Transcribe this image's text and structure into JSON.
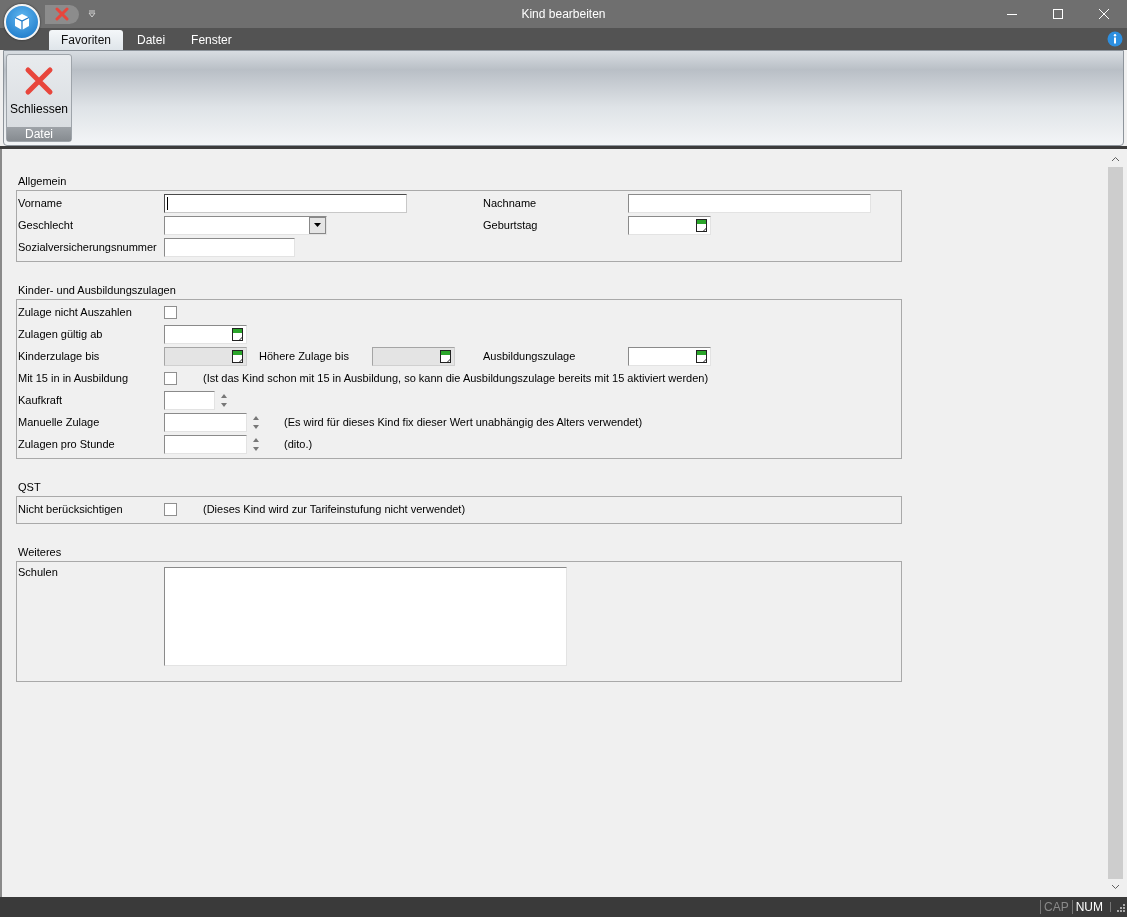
{
  "window": {
    "title": "Kind bearbeiten"
  },
  "ribbon": {
    "tabs": [
      {
        "label": "Favoriten",
        "selected": true
      },
      {
        "label": "Datei",
        "selected": false
      },
      {
        "label": "Fenster",
        "selected": false
      }
    ],
    "groups": [
      {
        "label": "Datei",
        "buttons": [
          {
            "label": "Schliessen"
          }
        ]
      }
    ]
  },
  "sections": [
    {
      "title": "Allgemein",
      "rows": [
        {
          "label": "Vorname",
          "control": {
            "kind": "text",
            "focused": true
          },
          "extras": [
            {
              "label": "Nachname",
              "control": {
                "kind": "text",
                "focused": false
              }
            }
          ]
        },
        {
          "label": "Geschlecht",
          "control": {
            "kind": "combo"
          },
          "extras": [
            {
              "label": "Geburtstag",
              "control": {
                "kind": "date",
                "disabled": false
              }
            }
          ]
        },
        {
          "label": "Sozialversicherungsnummer",
          "control": {
            "kind": "text",
            "focused": false
          }
        }
      ]
    },
    {
      "title": "Kinder- und Ausbildungszulagen",
      "rows": [
        {
          "label": "Zulage nicht Auszahlen",
          "control": {
            "kind": "checkbox",
            "checked": false
          }
        },
        {
          "label": "Zulagen gültig ab",
          "control": {
            "kind": "date",
            "disabled": false
          }
        },
        {
          "label": "Kinderzulage bis",
          "control": {
            "kind": "date",
            "disabled": true
          },
          "extras": [
            {
              "label": "Höhere Zulage bis",
              "control": {
                "kind": "date",
                "disabled": true
              }
            },
            {
              "label": "Ausbildungszulage",
              "control": {
                "kind": "date",
                "disabled": false
              }
            }
          ]
        },
        {
          "label": "Mit 15 in in Ausbildung",
          "control": {
            "kind": "checkbox",
            "checked": false
          },
          "note": "(Ist das Kind schon mit 15 in Ausbildung, so kann die Ausbildungszulage bereits mit 15 aktiviert werden)"
        },
        {
          "label": "Kaufkraft",
          "control": {
            "kind": "spin"
          }
        },
        {
          "label": "Manuelle Zulage",
          "control": {
            "kind": "spin"
          },
          "note": "(Es wird für dieses Kind fix dieser Wert unabhängig des Alters verwendet)"
        },
        {
          "label": "Zulagen pro Stunde",
          "control": {
            "kind": "spin"
          },
          "note": "(dito.)"
        }
      ]
    },
    {
      "title": "QST",
      "rows": [
        {
          "label": "Nicht berücksichtigen",
          "control": {
            "kind": "checkbox",
            "checked": false
          },
          "note": "(Dieses Kind wird zur Tarifeinstufung nicht verwendet)"
        }
      ]
    },
    {
      "title": "Weiteres",
      "rows": [
        {
          "label": "Schulen",
          "control": {
            "kind": "textarea"
          }
        }
      ]
    }
  ],
  "status_bar": {
    "indicators": [
      {
        "label": "CAP",
        "on": false
      },
      {
        "label": "NUM",
        "on": true
      }
    ]
  }
}
